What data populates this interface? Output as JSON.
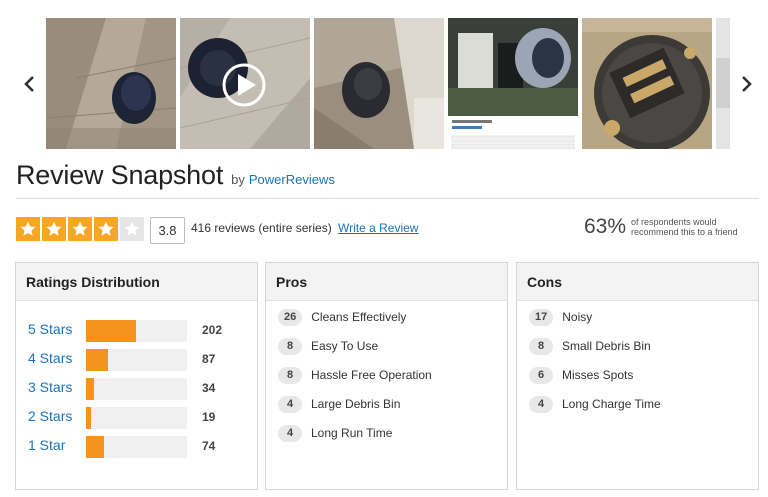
{
  "header": {
    "title": "Review Snapshot",
    "by_text": "by",
    "provider_link": "PowerReviews"
  },
  "carousel": {
    "prev_icon": "chevron-left-icon",
    "next_icon": "chevron-right-icon",
    "thumbnails": [
      "robot-vacuum-on-wood-floor",
      "video-robot-vacuum",
      "robot-vacuum-in-room",
      "robot-vacuum-app-screenshot",
      "robot-vacuum-underside-brushes",
      "partial-thumbnail"
    ]
  },
  "rating": {
    "stars_filled": 4,
    "stars_total": 5,
    "score": "3.8",
    "reviews_text": "416 reviews (entire series)",
    "write_review": "Write a Review",
    "recommend_pct": "63%",
    "recommend_text": "of respondents would recommend this to a friend",
    "star_color": "#f5a623"
  },
  "distribution": {
    "title": "Ratings Distribution",
    "bar_color": "#f5931f",
    "rows": [
      {
        "label": "5 Stars",
        "count": "202",
        "value": 202
      },
      {
        "label": "4 Stars",
        "count": "87",
        "value": 87
      },
      {
        "label": "3 Stars",
        "count": "34",
        "value": 34
      },
      {
        "label": "2 Stars",
        "count": "19",
        "value": 19
      },
      {
        "label": "1 Star",
        "count": "74",
        "value": 74
      }
    ]
  },
  "pros": {
    "title": "Pros",
    "items": [
      {
        "count": "26",
        "label": "Cleans Effectively"
      },
      {
        "count": "8",
        "label": "Easy To Use"
      },
      {
        "count": "8",
        "label": "Hassle Free Operation"
      },
      {
        "count": "4",
        "label": "Large Debris Bin"
      },
      {
        "count": "4",
        "label": "Long Run Time"
      }
    ]
  },
  "cons": {
    "title": "Cons",
    "items": [
      {
        "count": "17",
        "label": "Noisy"
      },
      {
        "count": "8",
        "label": "Small Debris Bin"
      },
      {
        "count": "6",
        "label": "Misses Spots"
      },
      {
        "count": "4",
        "label": "Long Charge Time"
      }
    ]
  }
}
